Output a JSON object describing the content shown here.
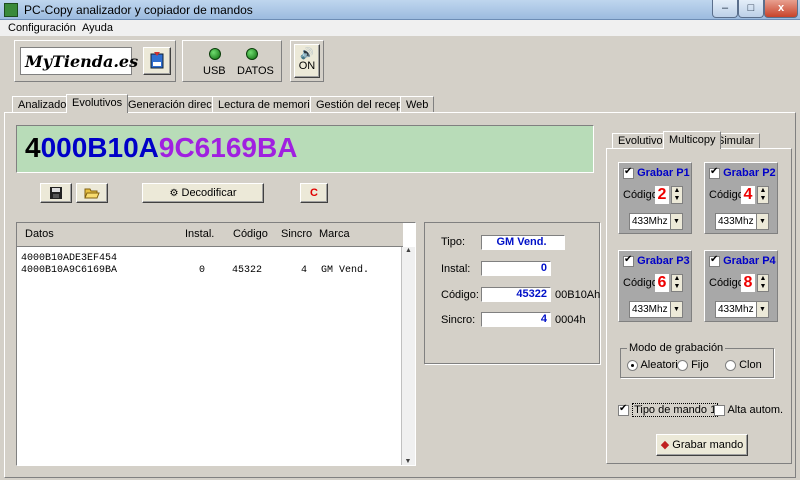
{
  "window": {
    "title": "PC-Copy analizador y copiador de mandos",
    "minimize": "–",
    "maximize": "□",
    "close": "x"
  },
  "menu": {
    "items": [
      "Configuración",
      "Ayuda"
    ]
  },
  "brand": {
    "logo_text": "MyTienda.es"
  },
  "status": {
    "usb_label": "USB",
    "datos_label": "DATOS",
    "sound_label": "ON"
  },
  "tabs": [
    "Analizador",
    "Evolutivos",
    "Generación directa",
    "Lectura de memorias",
    "Gestión del receptor",
    "Web"
  ],
  "active_tab": "Evolutivos",
  "code_display": {
    "part1": "4",
    "part2": "000B10A",
    "part3": "9C6169BA"
  },
  "toolbar": {
    "decode_label": "Decodificar",
    "c_label": "C"
  },
  "table": {
    "headers": [
      "Datos",
      "Instal.",
      "Código",
      "Sincro",
      "Marca"
    ],
    "rows": [
      {
        "datos": "4000B10ADE3EF454",
        "instal": "",
        "codigo": "",
        "sincro": "",
        "marca": ""
      },
      {
        "datos": "4000B10A9C6169BA",
        "instal": "0",
        "codigo": "45322",
        "sincro": "4",
        "marca": "GM Vend."
      }
    ]
  },
  "details": {
    "tipo_label": "Tipo:",
    "tipo_value": "GM Vend.",
    "instal_label": "Instal:",
    "instal_value": "0",
    "codigo_label": "Código:",
    "codigo_value": "45322",
    "codigo_hex": "00B10Ah",
    "sincro_label": "Sincro:",
    "sincro_value": "4",
    "sincro_hex": "0004h"
  },
  "right_tabs": [
    "Evolutivos",
    "Multicopy",
    "Simular"
  ],
  "slots": [
    {
      "label": "Grabar P1",
      "code": "2",
      "freq": "433Mhz"
    },
    {
      "label": "Grabar P2",
      "code": "4",
      "freq": "433Mhz"
    },
    {
      "label": "Grabar P3",
      "code": "6",
      "freq": "433Mhz"
    },
    {
      "label": "Grabar P4",
      "code": "8",
      "freq": "433Mhz"
    }
  ],
  "slot_code_label": "Código:",
  "recording_mode": {
    "title": "Modo de grabación",
    "options": [
      "Aleatorio",
      "Fijo",
      "Clon"
    ],
    "selected": "Aleatorio"
  },
  "options": {
    "tipo_mando_label": "Tipo de mando 1",
    "tipo_mando_checked": true,
    "alta_autom_label": "Alta autom.",
    "alta_autom_checked": false
  },
  "grabar_button": "Grabar mando",
  "colors": {
    "code_part1": "#000000",
    "code_part2": "#0000c8",
    "code_part3": "#a020e0",
    "display_bg": "#b8dcb8"
  }
}
